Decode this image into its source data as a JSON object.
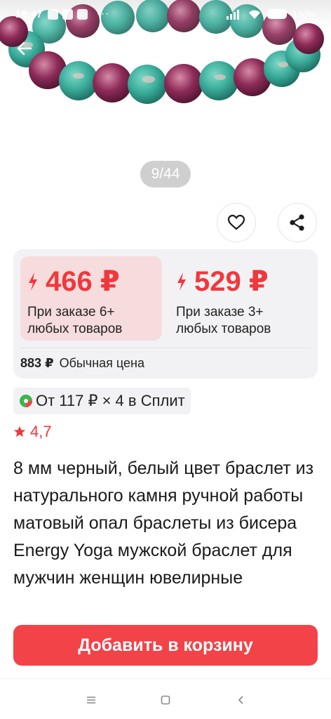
{
  "status_bar": {
    "time": "18:47",
    "overflow": "···",
    "battery_text": "100%"
  },
  "gallery": {
    "counter": "9/44"
  },
  "prices": [
    {
      "price": "466 ₽",
      "note_line1": "При заказе 6+",
      "note_line2": "любых товаров",
      "selected": true
    },
    {
      "price": "529 ₽",
      "note_line1": "При заказе 3+",
      "note_line2": "любых товаров",
      "selected": false
    }
  ],
  "regular_price": {
    "value": "883 ₽",
    "label": "Обычная цена"
  },
  "split": {
    "text": "От 117 ₽ × 4 в Сплит"
  },
  "rating": {
    "value": "4,7"
  },
  "product": {
    "title": "8 мм черный, белый цвет браслет из натурального камня ручной работы матовый опал браслеты из бисера Energy Yoga мужской браслет для мужчин женщин ювелирные"
  },
  "actions": {
    "add_to_cart": "Добавить в корзину"
  },
  "colors": {
    "accent": "#f0383c",
    "button": "#f24348",
    "selected_bg": "#f6dcdd",
    "card_bg": "#f2f2f4"
  },
  "icons": {
    "back": "arrow-left-icon",
    "favorite": "heart-icon",
    "share": "share-icon",
    "price": "lightning-icon",
    "rating": "star-icon",
    "split": "split-logo-icon",
    "nav_menu": "menu-icon",
    "nav_home": "home-square-icon",
    "nav_back": "chevron-left-icon"
  }
}
